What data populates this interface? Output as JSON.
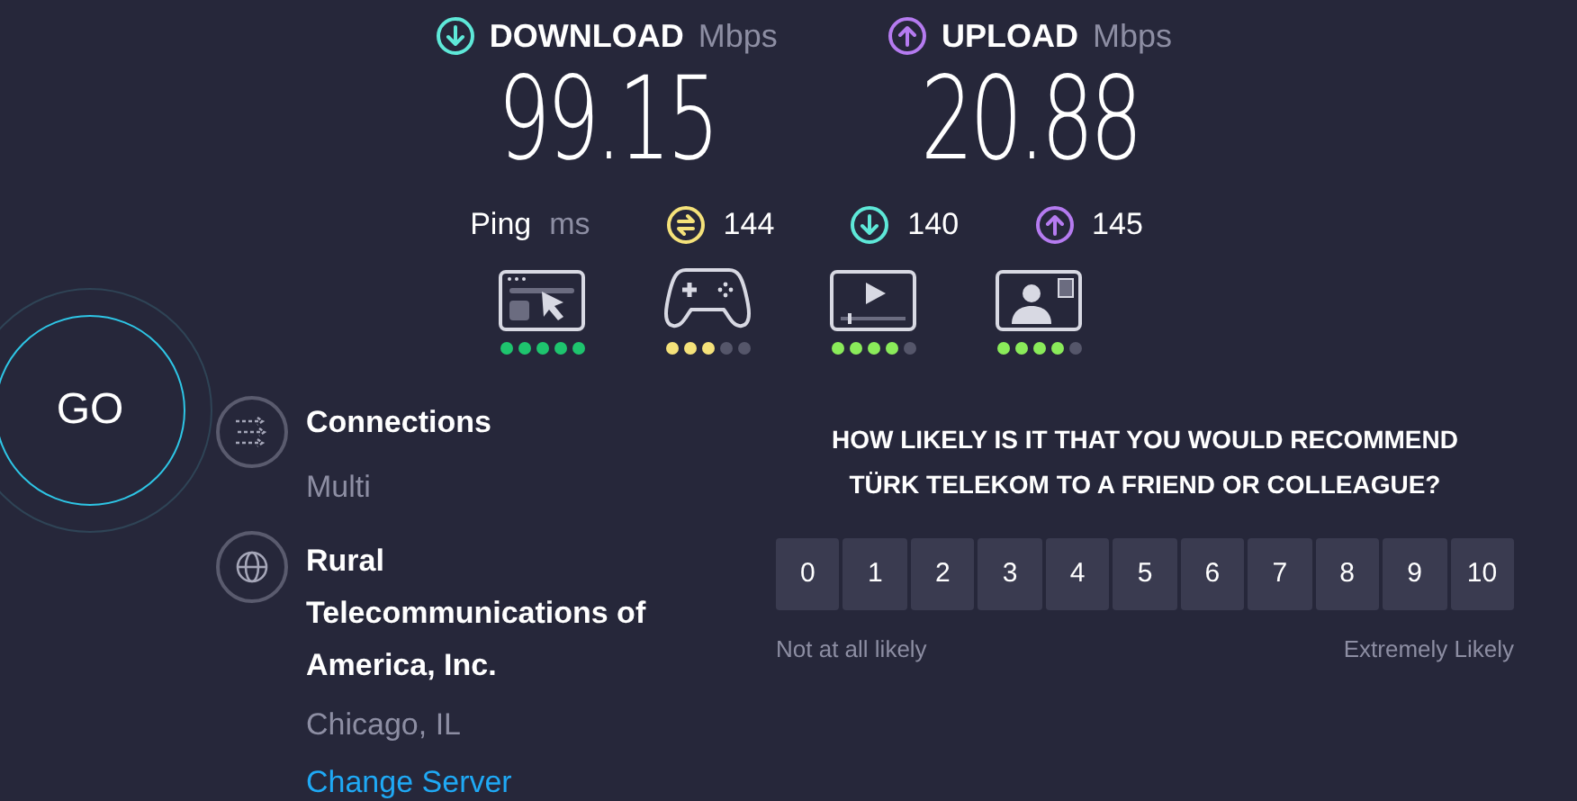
{
  "results": [
    {
      "kind": "download",
      "label": "DOWNLOAD",
      "unit": "Mbps",
      "value": "99.15"
    },
    {
      "kind": "upload",
      "label": "UPLOAD",
      "unit": "Mbps",
      "value": "20.88"
    }
  ],
  "ping": {
    "label": "Ping",
    "unit": "ms",
    "values": [
      {
        "kind": "idle",
        "value": "144"
      },
      {
        "kind": "download",
        "value": "140"
      },
      {
        "kind": "upload",
        "value": "145"
      }
    ]
  },
  "quality": [
    {
      "kind": "browsing",
      "stars": 5,
      "color": "#1ec46e"
    },
    {
      "kind": "gaming",
      "stars": 3,
      "color": "#f5e27a"
    },
    {
      "kind": "streaming",
      "stars": 4,
      "color": "#8aeb5a"
    },
    {
      "kind": "video-call",
      "stars": 4,
      "color": "#8aeb5a"
    }
  ],
  "go_button": {
    "label": "GO"
  },
  "connections": {
    "title": "Connections",
    "value": "Multi"
  },
  "server": {
    "name": "Rural Telecommunications of America, Inc.",
    "location": "Chicago, IL",
    "change_link": "Change Server"
  },
  "survey": {
    "question": "HOW LIKELY IS IT THAT YOU WOULD RECOMMEND TÜRK TELEKOM TO A FRIEND OR COLLEAGUE?",
    "scale": [
      "0",
      "1",
      "2",
      "3",
      "4",
      "5",
      "6",
      "7",
      "8",
      "9",
      "10"
    ],
    "low_label": "Not at all likely",
    "high_label": "Extremely Likely"
  }
}
